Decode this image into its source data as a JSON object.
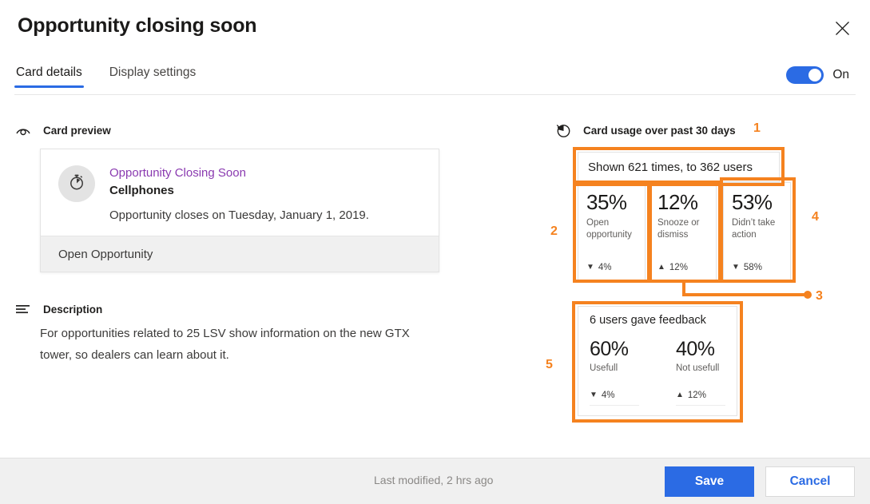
{
  "dialog": {
    "title": "Opportunity closing soon",
    "close_icon": "close-icon"
  },
  "tabs": [
    {
      "label": "Card details",
      "active": true
    },
    {
      "label": "Display settings",
      "active": false
    }
  ],
  "toggle": {
    "state_label": "On",
    "on": true,
    "accent": "#2b6be4"
  },
  "left": {
    "card_preview": {
      "section_icon": "eye-icon",
      "section_title": "Card preview",
      "avatar_icon": "stopwatch-icon",
      "title": "Opportunity Closing Soon",
      "title_color": "#8a3ab0",
      "subtitle": "Cellphones",
      "description": "Opportunity closes on Tuesday, January 1, 2019.",
      "action_label": "Open Opportunity"
    },
    "description": {
      "section_icon": "list-lines-icon",
      "section_title": "Description",
      "text": "For opportunities related to 25 LSV show information on the new GTX tower, so dealers can learn about it."
    }
  },
  "right": {
    "usage": {
      "section_icon": "pie-chart-icon",
      "section_title": "Card usage over past 30 days",
      "shown_summary": "Shown 621 times, to 362 users",
      "metrics": [
        {
          "value": "35%",
          "label": "Open opportunity",
          "delta": "4%",
          "direction": "down"
        },
        {
          "value": "12%",
          "label": "Snooze or dismiss",
          "delta": "12%",
          "direction": "up"
        },
        {
          "value": "53%",
          "label": "Didn’t take action",
          "delta": "58%",
          "direction": "down"
        }
      ]
    },
    "feedback": {
      "title": "6 users gave feedback",
      "stats": [
        {
          "value": "60%",
          "label": "Usefull",
          "delta": "4%",
          "direction": "down"
        },
        {
          "value": "40%",
          "label": "Not usefull",
          "delta": "12%",
          "direction": "up"
        }
      ]
    }
  },
  "annotations": {
    "color": "#f5821f",
    "numbers": [
      "1",
      "2",
      "3",
      "4",
      "5"
    ]
  },
  "footer": {
    "status": "Last modified, 2 hrs ago",
    "save_label": "Save",
    "cancel_label": "Cancel"
  },
  "glyphs": {
    "arrow_down": "▼",
    "arrow_up": "▲"
  }
}
